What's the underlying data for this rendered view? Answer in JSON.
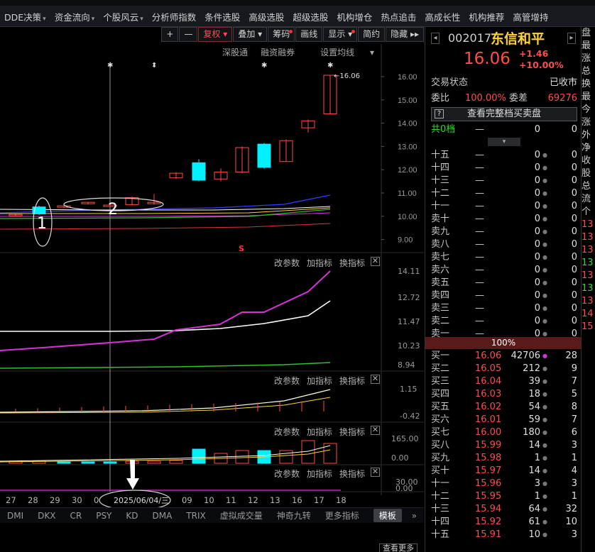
{
  "menu": [
    {
      "label": "DDE决策",
      "dd": true
    },
    {
      "label": "资金流向",
      "dd": true
    },
    {
      "label": "个股风云",
      "dd": true
    },
    {
      "label": "分析师指数",
      "dd": false
    },
    {
      "label": "条件选股",
      "dd": false
    },
    {
      "label": "高级选股",
      "dd": false
    },
    {
      "label": "超级选股",
      "dd": false
    },
    {
      "label": "机构增仓",
      "dd": false
    },
    {
      "label": "热点追击",
      "dd": false
    },
    {
      "label": "高成长性",
      "dd": false
    },
    {
      "label": "机构推荐",
      "dd": false
    },
    {
      "label": "高管增持",
      "dd": false
    }
  ],
  "toolbar": {
    "plus": "+",
    "minus": "—",
    "fuquan": "复权",
    "diejia": "叠加",
    "chouma": "筹码",
    "huaxian": "画线",
    "xianshi": "显示",
    "jianyue": "简约",
    "yincang": "隐藏"
  },
  "subtool": {
    "sgt": "深股通",
    "rzrq": "融资融券",
    "setma": "设置均线"
  },
  "candle_chart": {
    "yticks": [
      "16.00",
      "15.00",
      "14.00",
      "13.00",
      "12.00",
      "11.00",
      "10.00",
      "9.00"
    ],
    "max_label": "16.06",
    "annotation_1": "1",
    "annotation_2": "2",
    "s_marker": "S"
  },
  "indicator_header": {
    "gaicanshu": "改参数",
    "jiazhibiao": "加指标",
    "huanzhibiao": "换指标",
    "close": "✕"
  },
  "ind1_ticks": [
    "14.11",
    "12.72",
    "11.47",
    "10.23",
    "8.94"
  ],
  "ind2_ticks": [
    "1.15",
    "-0.42"
  ],
  "ind3_ticks": [
    "165.00",
    "0.00"
  ],
  "ind4_ticks": [
    "30.00",
    "0.00"
  ],
  "date_axis": [
    "27",
    "28",
    "29",
    "30",
    "06",
    "09",
    "10",
    "11",
    "12",
    "13",
    "16",
    "17",
    "18"
  ],
  "date_callout": "2025/06/04/三",
  "bottom_tabs": [
    "DMI",
    "DKX",
    "CR",
    "PSY",
    "KD",
    "DMA",
    "TRIX",
    "虚拟成交量",
    "神奇九转",
    "更多指标",
    "模板"
  ],
  "more_button": "查看更多",
  "sidebar": {
    "code": "002017",
    "name": "东信和平",
    "price": "16.06",
    "change": "+1.46",
    "change_pct": "+10.00%",
    "status_label": "交易状态",
    "status_value": "已收市",
    "weibi_label": "委比",
    "weibi_value": "100.00%",
    "weicha_label": "委差",
    "weicha_value": "69276",
    "full_book_btn": "查看完整档买卖盘",
    "total_row": {
      "label": "共0档",
      "price": "—",
      "vol": "0",
      "count": "0"
    },
    "ask_rows": [
      {
        "label": "十五",
        "price": "—",
        "vol": "0",
        "count": "0"
      },
      {
        "label": "十四",
        "price": "—",
        "vol": "0",
        "count": "0"
      },
      {
        "label": "十三",
        "price": "—",
        "vol": "0",
        "count": "0"
      },
      {
        "label": "十二",
        "price": "—",
        "vol": "0",
        "count": "0"
      },
      {
        "label": "十一",
        "price": "—",
        "vol": "0",
        "count": "0"
      },
      {
        "label": "卖十",
        "price": "—",
        "vol": "0",
        "count": "0"
      },
      {
        "label": "卖九",
        "price": "—",
        "vol": "0",
        "count": "0"
      },
      {
        "label": "卖八",
        "price": "—",
        "vol": "0",
        "count": "0"
      },
      {
        "label": "卖七",
        "price": "—",
        "vol": "0",
        "count": "0"
      },
      {
        "label": "卖六",
        "price": "—",
        "vol": "0",
        "count": "0"
      },
      {
        "label": "卖五",
        "price": "—",
        "vol": "0",
        "count": "0"
      },
      {
        "label": "卖四",
        "price": "—",
        "vol": "0",
        "count": "0"
      },
      {
        "label": "卖三",
        "price": "—",
        "vol": "0",
        "count": "0"
      },
      {
        "label": "卖二",
        "price": "—",
        "vol": "0",
        "count": "0"
      },
      {
        "label": "卖一",
        "price": "—",
        "vol": "0",
        "count": "0"
      }
    ],
    "divider_pct": "100%",
    "bid_rows": [
      {
        "label": "买一",
        "price": "16.06",
        "vol": "42706",
        "count": "28"
      },
      {
        "label": "买二",
        "price": "16.05",
        "vol": "212",
        "count": "9"
      },
      {
        "label": "买三",
        "price": "16.04",
        "vol": "39",
        "count": "7"
      },
      {
        "label": "买四",
        "price": "16.03",
        "vol": "18",
        "count": "5"
      },
      {
        "label": "买五",
        "price": "16.02",
        "vol": "54",
        "count": "8"
      },
      {
        "label": "买六",
        "price": "16.01",
        "vol": "59",
        "count": "7"
      },
      {
        "label": "买七",
        "price": "16.00",
        "vol": "180",
        "count": "6"
      },
      {
        "label": "买八",
        "price": "15.99",
        "vol": "14",
        "count": "3"
      },
      {
        "label": "买九",
        "price": "15.98",
        "vol": "1",
        "count": "1"
      },
      {
        "label": "买十",
        "price": "15.97",
        "vol": "14",
        "count": "4"
      },
      {
        "label": "十一",
        "price": "15.96",
        "vol": "3",
        "count": "3"
      },
      {
        "label": "十二",
        "price": "15.95",
        "vol": "1",
        "count": "1"
      },
      {
        "label": "十三",
        "price": "15.94",
        "vol": "64",
        "count": "32"
      },
      {
        "label": "十四",
        "price": "15.92",
        "vol": "61",
        "count": "10"
      },
      {
        "label": "十五",
        "price": "15.91",
        "vol": "10",
        "count": "3"
      }
    ]
  },
  "farright": [
    "盘",
    "最",
    "涨",
    "总",
    "换",
    "最",
    "今",
    "涨",
    "外",
    "净",
    "收",
    "股",
    "总",
    "流",
    "",
    "个",
    "13",
    "13",
    "13",
    "13",
    "13",
    "13",
    "13",
    "14",
    "",
    "15"
  ]
}
